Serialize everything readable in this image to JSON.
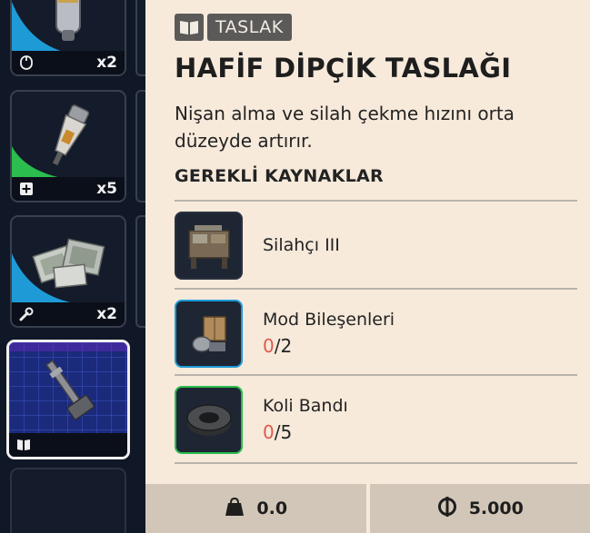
{
  "inventory": {
    "slots": [
      {
        "quantity": "x2",
        "footer_icon": "mouse-icon",
        "accent": "#1e9bd7"
      },
      {
        "quantity": "x5",
        "footer_icon": "plus-icon",
        "accent": "#2bbd4e"
      },
      {
        "quantity": "x2",
        "footer_icon": "wrench-icon",
        "accent": "#1e9bd7"
      },
      {
        "quantity": "",
        "footer_icon": "book-icon",
        "accent": "#8a3fd6"
      }
    ]
  },
  "detail": {
    "tag_icon": "book-icon",
    "tag_label": "TASLAK",
    "title": "HAFİF DİPÇİK TASLAĞI",
    "description": "Nişan alma ve silah çekme hızını orta düzeyde artırır.",
    "section_title": "GEREKLİ KAYNAKLAR",
    "resources": [
      {
        "name": "Silahçı III",
        "have": "",
        "sep_need": "",
        "icon": "workbench-icon",
        "border": "#2a3140"
      },
      {
        "name": "Mod Bileşenleri",
        "have": "0",
        "sep_need": "/2",
        "icon": "mod-components-icon",
        "border": "#1e9bd7"
      },
      {
        "name": "Koli Bandı",
        "have": "0",
        "sep_need": "/5",
        "icon": "duct-tape-icon",
        "border": "#2bbd4e"
      }
    ]
  },
  "footer": {
    "weight_icon": "weight-icon",
    "weight": "0.0",
    "price_icon": "coin-icon",
    "price": "5.000"
  }
}
